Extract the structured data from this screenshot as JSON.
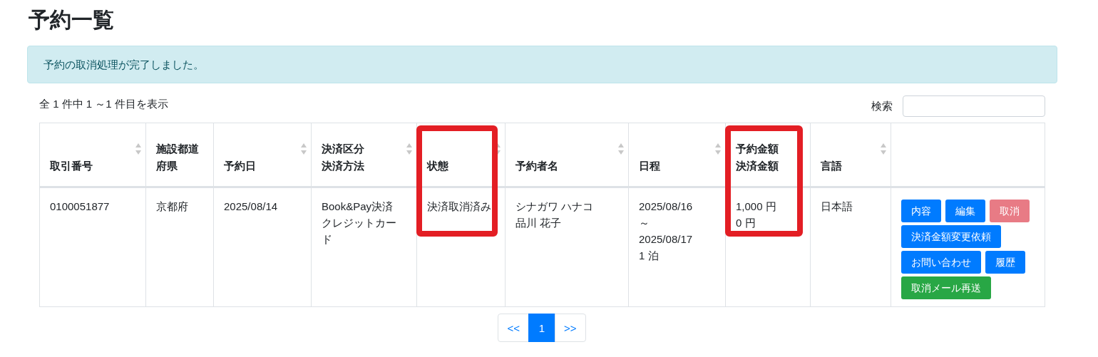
{
  "title": "予約一覧",
  "alert": {
    "text": "予約の取消処理が完了しました。"
  },
  "info": "全 1 件中 1 ～1 件目を表示",
  "search": {
    "label": "検索"
  },
  "table": {
    "columns": [
      {
        "lines": [
          "取引番号"
        ],
        "sortable": true,
        "highlighted": false
      },
      {
        "lines": [
          "施設都道",
          "府県"
        ],
        "sortable": false,
        "highlighted": false
      },
      {
        "lines": [
          "予約日"
        ],
        "sortable": true,
        "highlighted": false
      },
      {
        "lines": [
          "決済区分",
          "決済方法"
        ],
        "sortable": true,
        "highlighted": false
      },
      {
        "lines": [
          "状態"
        ],
        "sortable": true,
        "highlighted": true
      },
      {
        "lines": [
          "予約者名"
        ],
        "sortable": true,
        "highlighted": false
      },
      {
        "lines": [
          "日程"
        ],
        "sortable": true,
        "highlighted": false
      },
      {
        "lines": [
          "予約金額",
          "決済金額"
        ],
        "sortable": false,
        "highlighted": true
      },
      {
        "lines": [
          "言語"
        ],
        "sortable": true,
        "highlighted": false
      },
      {
        "sortable": false,
        "highlighted": false
      }
    ],
    "rows": [
      {
        "cells": [
          {
            "lines": [
              "0100051877"
            ]
          },
          {
            "lines": [
              "京都府"
            ]
          },
          {
            "lines": [
              "2025/08/14"
            ]
          },
          {
            "lines": [
              "Book&Pay決済",
              "クレジットカード"
            ]
          },
          {
            "lines": [
              "決済取消済み"
            ]
          },
          {
            "lines": [
              "シナガワ ハナコ",
              "品川 花子"
            ]
          },
          {
            "lines": [
              "2025/08/16",
              "～",
              "2025/08/17",
              "1 泊"
            ]
          },
          {
            "lines": [
              "1,000 円",
              "0 円"
            ]
          },
          {
            "lines": [
              "日本語"
            ]
          }
        ],
        "button_rows": [
          [
            {
              "label": "内容",
              "kind": "primary",
              "disabled": false
            },
            {
              "label": "編集",
              "kind": "primary",
              "disabled": false
            },
            {
              "label": "取消",
              "kind": "danger",
              "disabled": true
            }
          ],
          [
            {
              "label": "決済金額変更依頼",
              "kind": "primary",
              "disabled": false
            }
          ],
          [
            {
              "label": "お問い合わせ",
              "kind": "primary",
              "disabled": false
            },
            {
              "label": "履歴",
              "kind": "primary",
              "disabled": false
            }
          ],
          [
            {
              "label": "取消メール再送",
              "kind": "success",
              "disabled": false
            }
          ]
        ]
      }
    ]
  },
  "pagination": [
    {
      "label": "<<",
      "selected": false
    },
    {
      "label": "1",
      "selected": true
    },
    {
      "label": ">>",
      "selected": false
    }
  ]
}
